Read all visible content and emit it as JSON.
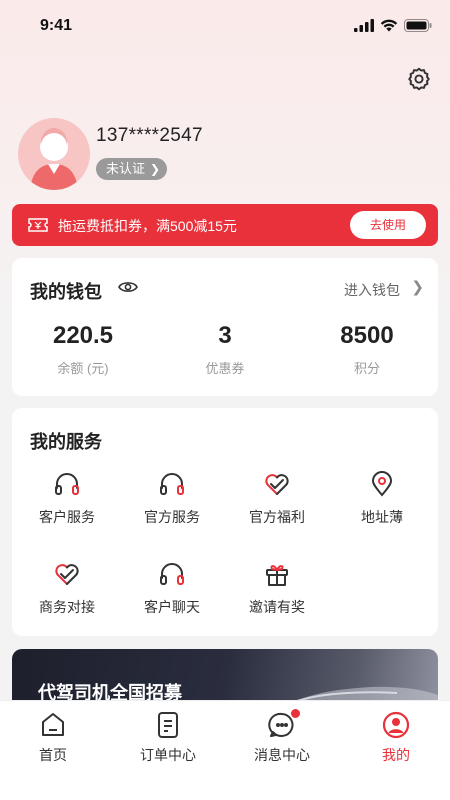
{
  "status": {
    "time": "9:41"
  },
  "profile": {
    "phone": "137****2547",
    "verify_label": "未认证"
  },
  "coupon": {
    "text": "拖运费抵扣券，满500减15元",
    "button": "去使用"
  },
  "wallet": {
    "title": "我的钱包",
    "link": "进入钱包",
    "stats": [
      {
        "value": "220.5",
        "label": "余额 (元)"
      },
      {
        "value": "3",
        "label": "优惠券"
      },
      {
        "value": "8500",
        "label": "积分"
      }
    ]
  },
  "services": {
    "title": "我的服务",
    "items": [
      {
        "label": "客户服务",
        "icon": "headset-icon"
      },
      {
        "label": "官方服务",
        "icon": "headset-icon"
      },
      {
        "label": "官方福利",
        "icon": "heart-check-icon"
      },
      {
        "label": "地址薄",
        "icon": "location-pin-icon"
      },
      {
        "label": "商务对接",
        "icon": "heart-check-icon"
      },
      {
        "label": "客户聊天",
        "icon": "headset-icon"
      },
      {
        "label": "邀请有奖",
        "icon": "gift-icon"
      }
    ]
  },
  "promo": {
    "text": "代驾司机全国招募"
  },
  "tabs": [
    {
      "label": "首页",
      "icon": "home-icon"
    },
    {
      "label": "订单中心",
      "icon": "order-icon"
    },
    {
      "label": "消息中心",
      "icon": "message-icon"
    },
    {
      "label": "我的",
      "icon": "profile-icon"
    }
  ],
  "colors": {
    "accent": "#e8313b",
    "avatar_bg": "#f8c5c5",
    "badge_gray": "#9a9a9a"
  }
}
